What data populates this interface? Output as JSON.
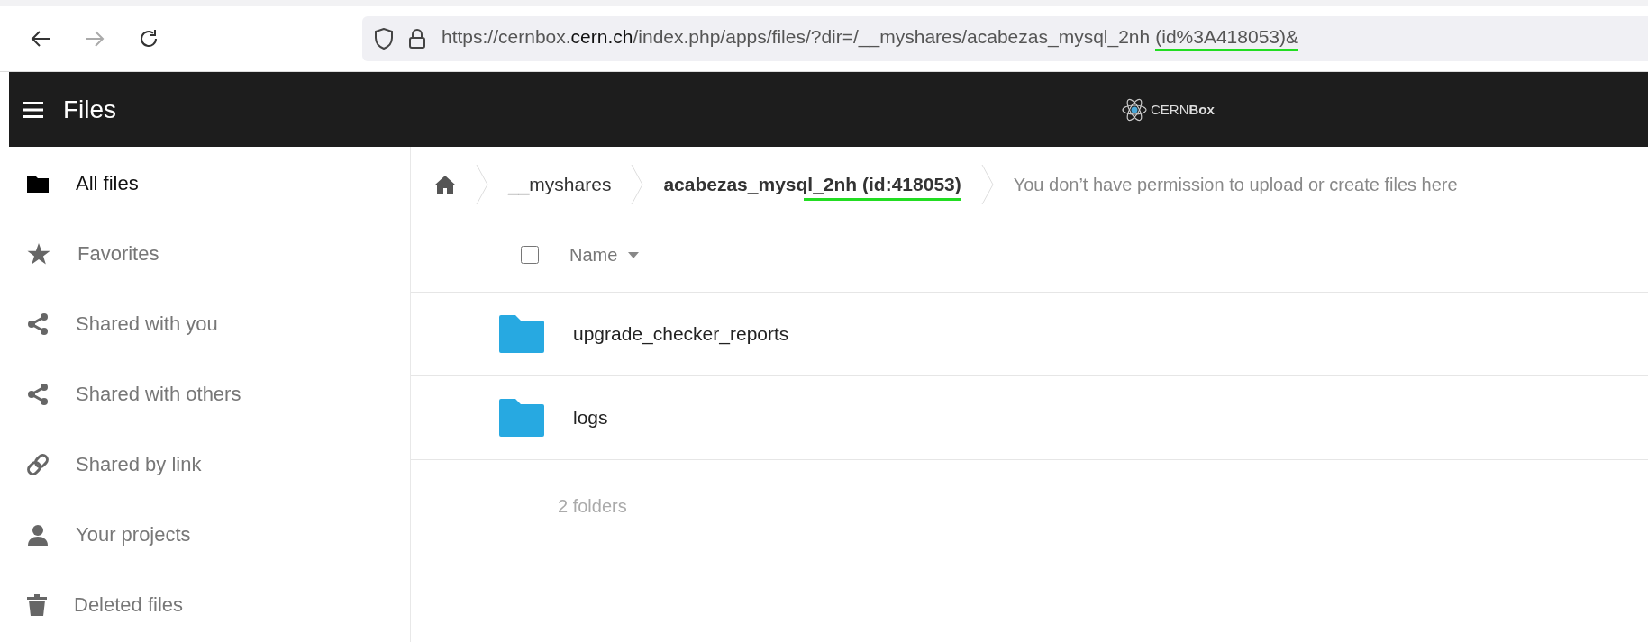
{
  "browser": {
    "url_parts": [
      {
        "text": "https://cernbox.",
        "emphasized": false,
        "highlighted": false
      },
      {
        "text": "cern.ch",
        "emphasized": true,
        "highlighted": false
      },
      {
        "text": "/index.php/apps/files/?dir=/__myshares/acabezas_mysql_2nh",
        "emphasized": false,
        "highlighted": false
      },
      {
        "text": "(id%3A418053)&",
        "emphasized": false,
        "highlighted": true
      }
    ],
    "forward_disabled": true
  },
  "header": {
    "title": "Files",
    "logo_text_light": "CERN",
    "logo_text_bold": "Box"
  },
  "sidebar": {
    "items": [
      {
        "kind": "folder",
        "label": "All files",
        "selected": true
      },
      {
        "kind": "star",
        "label": "Favorites",
        "selected": false
      },
      {
        "kind": "share",
        "label": "Shared with you",
        "selected": false
      },
      {
        "kind": "share",
        "label": "Shared with others",
        "selected": false
      },
      {
        "kind": "link",
        "label": "Shared by link",
        "selected": false
      },
      {
        "kind": "person",
        "label": "Your projects",
        "selected": false
      },
      {
        "kind": "trash",
        "label": "Deleted files",
        "selected": false
      }
    ]
  },
  "breadcrumb": {
    "crumbs": [
      {
        "kind": "home"
      },
      {
        "kind": "text",
        "label": "__myshares",
        "current": false
      },
      {
        "kind": "text",
        "label": "acabezas_mysql_2nh (id:418053)",
        "current": true,
        "highlighted": true
      }
    ],
    "notice": "You don’t have permission to upload or create files here"
  },
  "table": {
    "select_all_checked": false,
    "name_column": "Name",
    "rows": [
      {
        "name": "upgrade_checker_reports"
      },
      {
        "name": "logs"
      }
    ],
    "summary": "2 folders"
  }
}
